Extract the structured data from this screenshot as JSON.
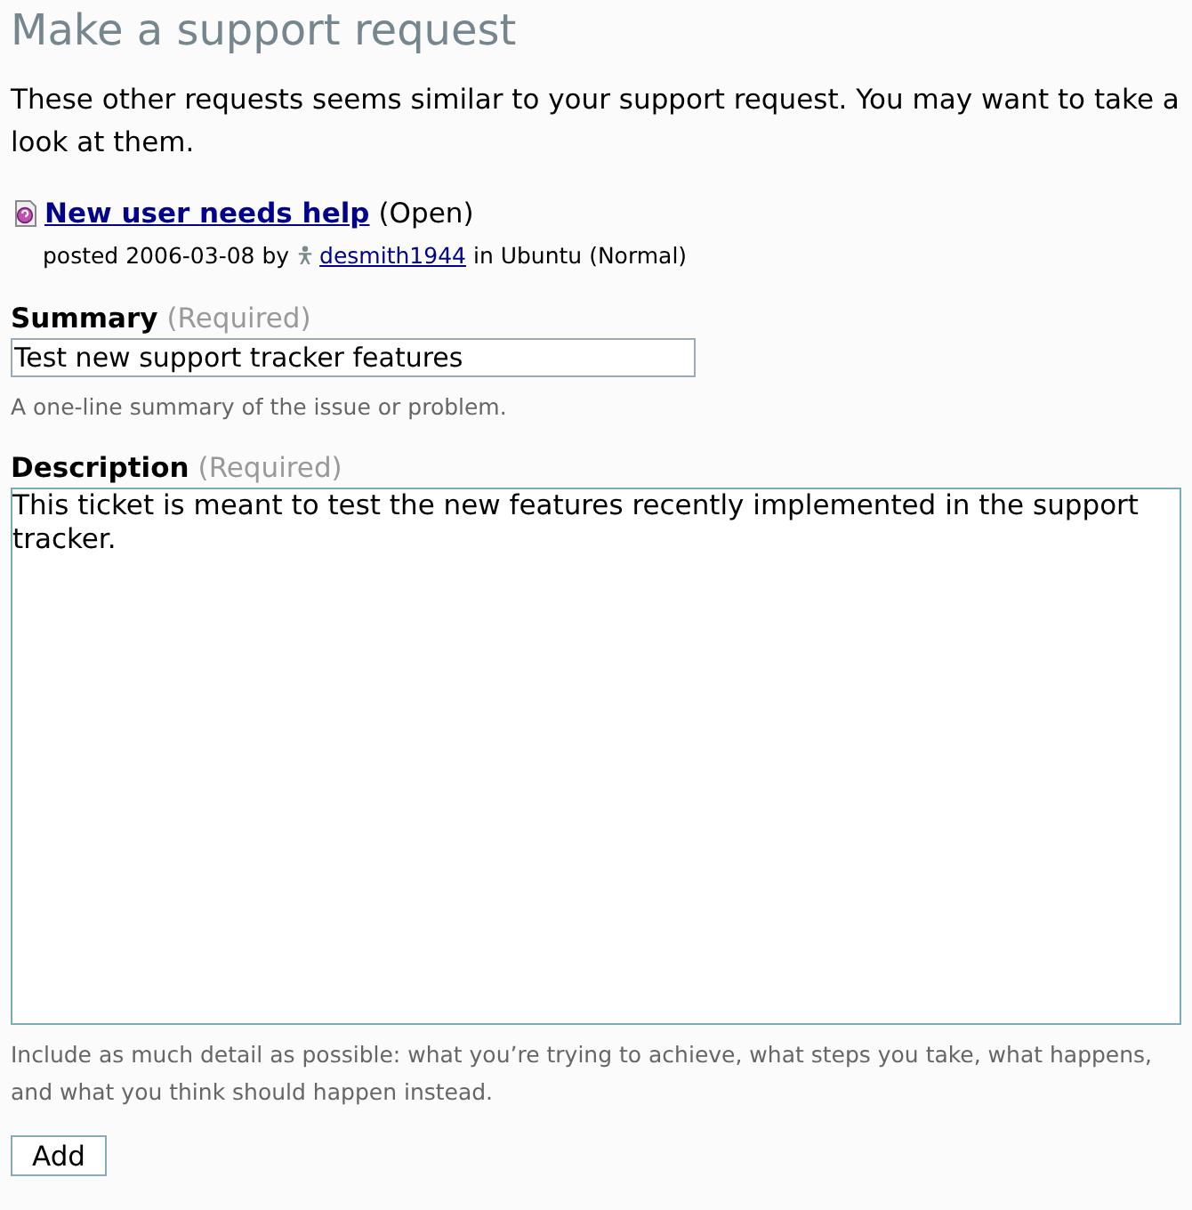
{
  "page_title": "Make a support request",
  "intro": "These other requests seems similar to your support request. You may want to take a look at them.",
  "similar_requests": [
    {
      "title": "New user needs help",
      "status": "(Open)",
      "posted": "posted 2006-03-08 by",
      "author": "desmith1944",
      "context": "in Ubuntu (Normal)"
    }
  ],
  "fields": [
    {
      "kind": "line",
      "label": "Summary",
      "required": "(Required)",
      "value": "Test new support tracker features",
      "hint": "A one-line summary of the issue or problem."
    },
    {
      "kind": "area",
      "label": "Description",
      "required": "(Required)",
      "value": "This ticket is meant to test the new features recently implemented in the support tracker.",
      "hint": "Include as much detail as possible: what you’re trying to achieve, what steps you take, what happens, and what you think should happen instead."
    }
  ],
  "buttons": [
    "Add"
  ]
}
